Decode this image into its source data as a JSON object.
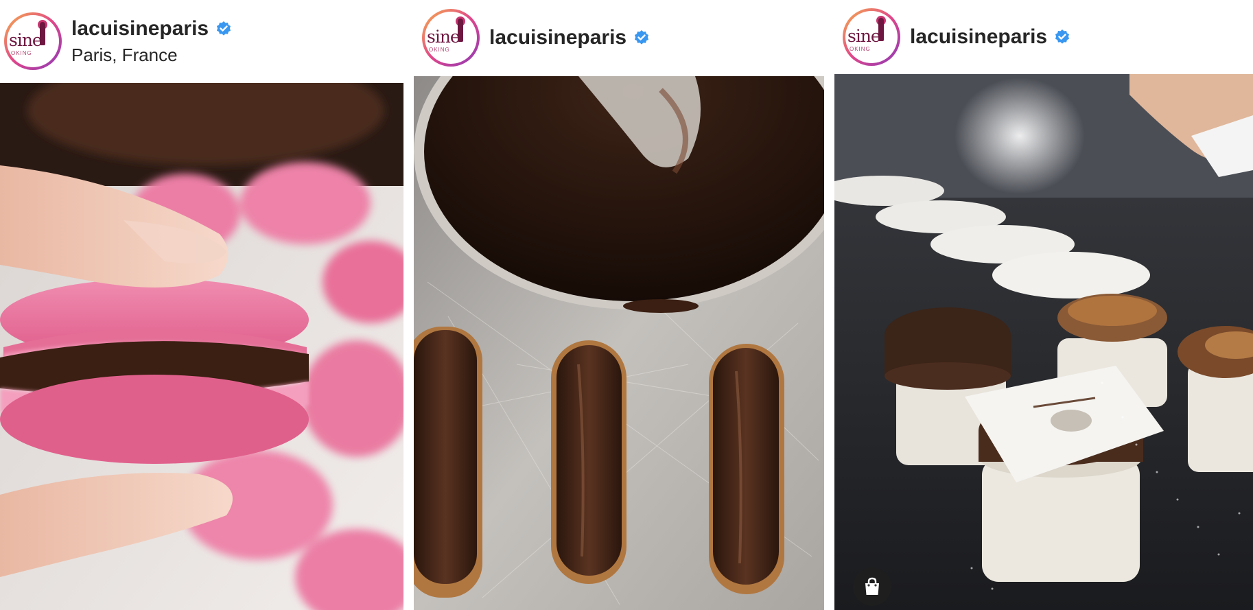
{
  "posts": [
    {
      "username": "lacuisineparis",
      "location": "Paris, France",
      "verified": true,
      "media_subject": "pink macaron"
    },
    {
      "username": "lacuisineparis",
      "verified": true,
      "media_subject": "chocolate eclairs"
    },
    {
      "username": "lacuisineparis",
      "verified": true,
      "media_subject": "chocolate souffles",
      "has_shopping_tag": true
    }
  ],
  "avatar": {
    "logo_text": "sine",
    "logo_subtext": "OKING"
  },
  "icons": {
    "verified": "verified-badge-icon",
    "shop": "shopping-bag-icon"
  },
  "colors": {
    "verified": "#3897f0",
    "username": "#262626",
    "macaron_pink": "#e5688f",
    "chocolate": "#3a1f12"
  }
}
